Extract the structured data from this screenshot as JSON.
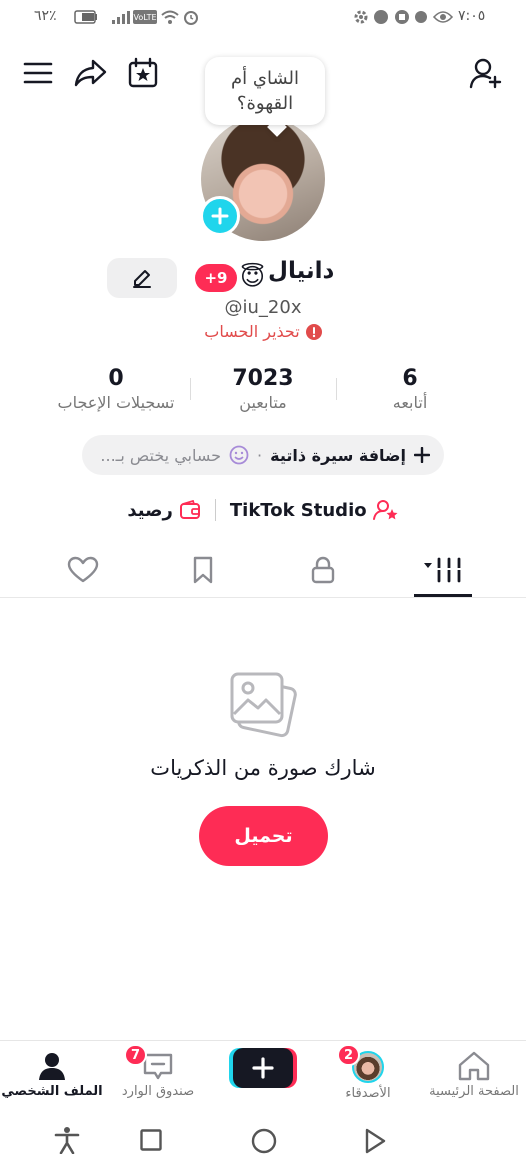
{
  "status_bar": {
    "battery": "٦٢٪",
    "time": "٧:٠٥"
  },
  "header": {
    "menu_icon": "hamburger-icon",
    "share_icon": "share-arrow-icon",
    "calendar_icon": "calendar-star-icon",
    "add_friend_icon": "add-user-icon"
  },
  "profile": {
    "bubble_text": "الشاي أم\nالقهوة؟",
    "name": "دانيال",
    "emoji": "😇",
    "level_badge": "+9",
    "username": "@iu_20x",
    "warning": "تحذير الحساب",
    "stats": [
      {
        "value": "6",
        "label": "أتابعه"
      },
      {
        "value": "7023",
        "label": "متابعين"
      },
      {
        "value": "0",
        "label": "تسجيلات الإعجاب"
      }
    ],
    "bio_add": "إضافة سيرة ذاتية",
    "bio_dot": "·",
    "bio_placeholder": "حسابي يختص بـ...",
    "studio_label": "TikTok Studio",
    "balance_label": "رصيد"
  },
  "tabs": [
    {
      "icon": "videos-grid-icon",
      "active": true
    },
    {
      "icon": "lock-icon",
      "active": false
    },
    {
      "icon": "bookmark-icon",
      "active": false
    },
    {
      "icon": "heart-icon",
      "active": false
    }
  ],
  "empty_state": {
    "icon": "photos-icon",
    "title": "شارك صورة من الذكريات",
    "button": "تحميل"
  },
  "bottom_nav": {
    "home": "الصفحة الرئيسية",
    "friends": "الأصدقاء",
    "friends_count": "2",
    "create": "+",
    "inbox": "صندوق الوارد",
    "inbox_count": "7",
    "profile": "الملف الشخصي"
  },
  "colors": {
    "brand_red": "#fe2c55",
    "brand_cyan": "#20d5ec",
    "text": "#161823"
  }
}
